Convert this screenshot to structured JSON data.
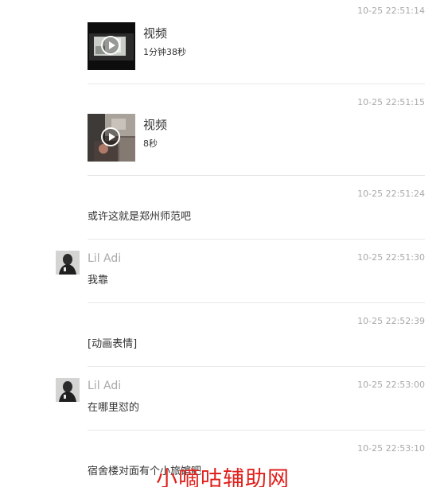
{
  "messages": [
    {
      "time": "10-25 22:51:14",
      "video_title": "视频",
      "video_duration": "1分钟38秒"
    },
    {
      "time": "10-25 22:51:15",
      "video_title": "视频",
      "video_duration": "8秒"
    },
    {
      "time": "10-25 22:51:24",
      "text": "或许这就是郑州师范吧"
    },
    {
      "time": "10-25 22:51:30",
      "sender": "Lil Adi",
      "text": "我靠"
    },
    {
      "time": "10-25 22:52:39",
      "text": "[动画表情]"
    },
    {
      "time": "10-25 22:53:00",
      "sender": "Lil Adi",
      "text": "在哪里怼的"
    },
    {
      "time": "10-25 22:53:10",
      "text": "宿舍楼对面有个小旅馆吧"
    }
  ],
  "watermark": "小嘀咕辅助网",
  "colors": {
    "timestamp": "#a9a9a9",
    "sender": "#a9a9a9",
    "text": "#333333",
    "separator": "#e7e7e7",
    "watermark": "#e0201c"
  },
  "icons": {
    "video_play": "play-icon"
  }
}
